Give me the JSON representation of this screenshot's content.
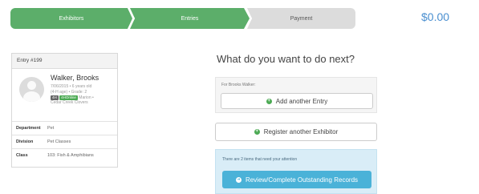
{
  "steps": [
    {
      "label": "Exhibitors",
      "state": "complete"
    },
    {
      "label": "Entries",
      "state": "complete"
    },
    {
      "label": "Payment",
      "state": "pending"
    }
  ],
  "cart_total": "$0.00",
  "entry_card": {
    "title": "Entry #199",
    "exhibitor_name": "Walker, Brooks",
    "meta_line1": "7/06/2015 • 6 years old",
    "meta_line2": "(4-H age) • Grade: 2",
    "badge1": "4H",
    "badge2": "4HOnline",
    "meta_line3": " Marion •",
    "meta_line4": "Cedar Creek Clovers",
    "rows": [
      {
        "key": "Department",
        "value": "Pet"
      },
      {
        "key": "Division",
        "value": "Pet Classes"
      },
      {
        "key": "Class",
        "value": "103: Fish & Amphibians"
      }
    ]
  },
  "next": {
    "heading": "What do you want to do next?",
    "panel_label": "For Brooks Walker:",
    "add_entry_label": "Add another Entry",
    "register_label": "Register another Exhibitor",
    "alert_text": "There are 2 items that need your attention",
    "review_label": "Review/Complete Outstanding Records"
  },
  "colors": {
    "step_complete": "#5cae6a",
    "step_pending": "#dcdcdc",
    "total": "#4a8fd0",
    "alert_bg": "#d9edf7",
    "review_button": "#4ab2d8"
  },
  "icons": {
    "add_icon": "plus-circle",
    "review_icon": "arrow-right-circle"
  }
}
